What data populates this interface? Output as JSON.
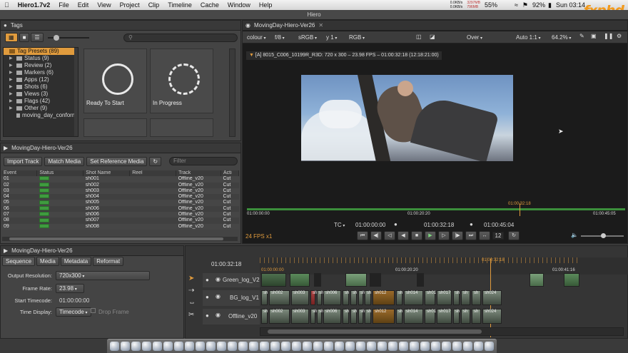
{
  "menubar": {
    "app": "Hiero1.7v2",
    "items": [
      "File",
      "Edit",
      "View",
      "Project",
      "Clip",
      "Timeline",
      "Cache",
      "Window",
      "Help"
    ],
    "net_up": "0.0KB/s",
    "net_down": "0.0KB/s",
    "mem_used": "3297MB",
    "mem_free": "796MB",
    "cpu": "55%",
    "battery": "92%",
    "clock": "Sun 03:14"
  },
  "window_title": "Hiero",
  "tags_panel": {
    "tab": "Tags",
    "search_placeholder": "",
    "tree": [
      {
        "label": "Tag Presets (89)",
        "selected": true
      },
      {
        "label": "Status (9)"
      },
      {
        "label": "Review (2)"
      },
      {
        "label": "Markers (6)"
      },
      {
        "label": "Apps (12)"
      },
      {
        "label": "Shots (6)"
      },
      {
        "label": "Views (3)"
      },
      {
        "label": "Flags (42)"
      },
      {
        "label": "Other (9)"
      },
      {
        "label": "moving_day_conform"
      }
    ],
    "tiles": [
      {
        "label": "Ready To Start"
      },
      {
        "label": "In Progress"
      }
    ]
  },
  "spreadsheet": {
    "tab": "MovingDay-Hiero-Ver26",
    "buttons": {
      "import": "Import Track",
      "match": "Match Media",
      "setref": "Set Reference Media"
    },
    "filter_placeholder": "Filter",
    "columns": [
      "Event",
      "Status",
      "Shot Name",
      "Reel",
      "Track",
      "Acti"
    ],
    "rows": [
      {
        "event": "01",
        "shot": "sh001",
        "track": "Offline_v20",
        "action": "Cut"
      },
      {
        "event": "02",
        "shot": "sh002",
        "track": "Offline_v20",
        "action": "Cut"
      },
      {
        "event": "03",
        "shot": "sh003",
        "track": "Offline_v20",
        "action": "Cut"
      },
      {
        "event": "04",
        "shot": "sh004",
        "track": "Offline_v20",
        "action": "Cut"
      },
      {
        "event": "05",
        "shot": "sh005",
        "track": "Offline_v20",
        "action": "Cut"
      },
      {
        "event": "06",
        "shot": "sh006",
        "track": "Offline_v20",
        "action": "Cut"
      },
      {
        "event": "07",
        "shot": "sh006",
        "track": "Offline_v20",
        "action": "Cut"
      },
      {
        "event": "08",
        "shot": "sh007",
        "track": "Offline_v20",
        "action": "Cut"
      },
      {
        "event": "09",
        "shot": "sh008",
        "track": "Offline_v20",
        "action": "Cut"
      }
    ]
  },
  "viewer": {
    "tab": "MovingDay-Hiero-Ver26",
    "channel": "colour",
    "fstop": "f/8",
    "colorspace": "sRGB",
    "gamma": "y 1",
    "rgb": "RGB",
    "composite": "Over",
    "auto": "Auto 1:1",
    "zoom": "64.2%",
    "clip_info": "[A] 8015_C006_10199R_R3D: 720 x 300 – 23.98 FPS – 01:00:32:18 (12:18:21:00)",
    "ruler": {
      "start": "01:00:00:00",
      "mid": "01:00:20:20",
      "end": "01:00:45:05",
      "playhead": "01:00:32:18"
    },
    "tc_label": "TC",
    "tc_in": "01:00:00:00",
    "tc_current": "01:00:32:18",
    "tc_out": "01:00:45:04",
    "step": "12",
    "fps": "24 FPS x1"
  },
  "settings_panel": {
    "tab": "MovingDay-Hiero-Ver26",
    "tabs": [
      "Sequence",
      "Media",
      "Metadata",
      "Reformat"
    ],
    "fields": {
      "resolution_label": "Output Resolution:",
      "resolution": "720x300",
      "framerate_label": "Frame Rate:",
      "framerate": "23.98",
      "starttc_label": "Start Timecode:",
      "starttc": "01:00:00:00",
      "display_label": "Time Display:",
      "display": "Timecode",
      "dropframe": "Drop Frame"
    }
  },
  "timeline": {
    "current_tc": "01:00:32:18",
    "ruler": {
      "start": "01:00:00:00",
      "playhead": "01:00:32:18",
      "mid": "01:00:20:20",
      "end": "01:00:41:16"
    },
    "tracks": [
      {
        "name": "Green_log_V2"
      },
      {
        "name": "BG_log_V1",
        "clips": [
          "sh",
          "sh002",
          "sh003",
          "sh",
          "sh",
          "sh006",
          "sh",
          "sh",
          "sh",
          "sh",
          "sh012",
          "sh",
          "sh014",
          "sh01",
          "sh017",
          "sh",
          "sh",
          "sh",
          "sh024"
        ]
      },
      {
        "name": "Offline_v20",
        "clips": [
          "sh",
          "sh002",
          "sh003",
          "sh",
          "sh",
          "sh006",
          "sh",
          "sh",
          "sh",
          "sh",
          "sh012",
          "sh",
          "sh014",
          "sh01",
          "sh017",
          "sh",
          "sh",
          "sh",
          "sh024"
        ]
      }
    ]
  },
  "watermark": "fxphd"
}
